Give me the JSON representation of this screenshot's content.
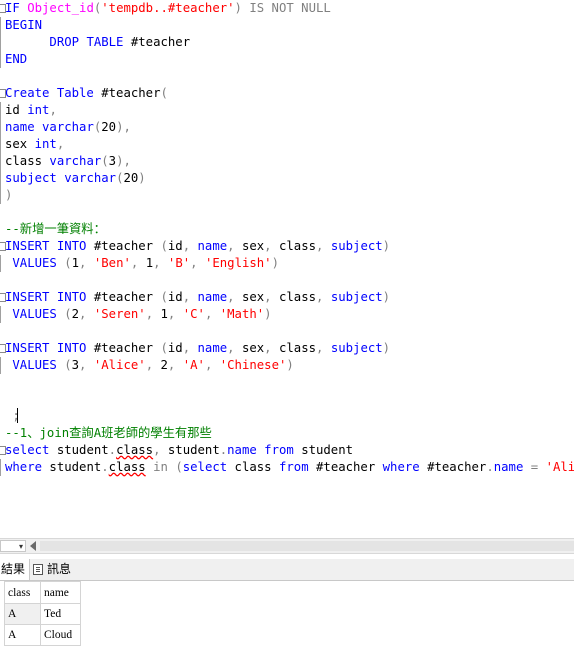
{
  "editor": {
    "lines": [
      [
        {
          "t": "IF ",
          "c": "kw"
        },
        {
          "t": "Object_id",
          "c": "fn"
        },
        {
          "t": "(",
          "c": "gray"
        },
        {
          "t": "'tempdb..#teacher'",
          "c": "str"
        },
        {
          "t": ")",
          "c": "gray"
        },
        {
          "t": " IS NOT NULL",
          "c": "gray"
        }
      ],
      [
        {
          "t": "BEGIN",
          "c": "kw"
        }
      ],
      [
        {
          "t": "      ",
          "c": ""
        },
        {
          "t": "DROP TABLE",
          "c": "kw"
        },
        {
          "t": " #teacher",
          "c": ""
        }
      ],
      [
        {
          "t": "END",
          "c": "kw"
        }
      ],
      [],
      [
        {
          "t": "Create Table",
          "c": "kw"
        },
        {
          "t": " #teacher",
          "c": ""
        },
        {
          "t": "(",
          "c": "gray"
        }
      ],
      [
        {
          "t": "id ",
          "c": ""
        },
        {
          "t": "int",
          "c": "kw"
        },
        {
          "t": ",",
          "c": "gray"
        }
      ],
      [
        {
          "t": "name ",
          "c": "kw"
        },
        {
          "t": "varchar",
          "c": "kw"
        },
        {
          "t": "(",
          "c": "gray"
        },
        {
          "t": "20",
          "c": ""
        },
        {
          "t": "),",
          "c": "gray"
        }
      ],
      [
        {
          "t": "sex ",
          "c": ""
        },
        {
          "t": "int",
          "c": "kw"
        },
        {
          "t": ",",
          "c": "gray"
        }
      ],
      [
        {
          "t": "class ",
          "c": ""
        },
        {
          "t": "varchar",
          "c": "kw"
        },
        {
          "t": "(",
          "c": "gray"
        },
        {
          "t": "3",
          "c": ""
        },
        {
          "t": "),",
          "c": "gray"
        }
      ],
      [
        {
          "t": "subject ",
          "c": "kw"
        },
        {
          "t": "varchar",
          "c": "kw"
        },
        {
          "t": "(",
          "c": "gray"
        },
        {
          "t": "20",
          "c": ""
        },
        {
          "t": ")",
          "c": "gray"
        }
      ],
      [
        {
          "t": ")",
          "c": "gray"
        }
      ],
      [],
      [
        {
          "t": "--新增一筆資料：",
          "c": "cm"
        }
      ],
      [
        {
          "t": "INSERT INTO",
          "c": "kw"
        },
        {
          "t": " #teacher ",
          "c": ""
        },
        {
          "t": "(",
          "c": "gray"
        },
        {
          "t": "id",
          "c": ""
        },
        {
          "t": ", ",
          "c": "gray"
        },
        {
          "t": "name",
          "c": "kw"
        },
        {
          "t": ", ",
          "c": "gray"
        },
        {
          "t": "sex",
          "c": ""
        },
        {
          "t": ", ",
          "c": "gray"
        },
        {
          "t": "class",
          "c": ""
        },
        {
          "t": ", ",
          "c": "gray"
        },
        {
          "t": "subject",
          "c": "kw"
        },
        {
          "t": ")",
          "c": "gray"
        }
      ],
      [
        {
          "t": " VALUES ",
          "c": "kw"
        },
        {
          "t": "(",
          "c": "gray"
        },
        {
          "t": "1",
          "c": ""
        },
        {
          "t": ", ",
          "c": "gray"
        },
        {
          "t": "'Ben'",
          "c": "str"
        },
        {
          "t": ", ",
          "c": "gray"
        },
        {
          "t": "1",
          "c": ""
        },
        {
          "t": ", ",
          "c": "gray"
        },
        {
          "t": "'B'",
          "c": "str"
        },
        {
          "t": ", ",
          "c": "gray"
        },
        {
          "t": "'English'",
          "c": "str"
        },
        {
          "t": ")",
          "c": "gray"
        }
      ],
      [],
      [
        {
          "t": "INSERT INTO",
          "c": "kw"
        },
        {
          "t": " #teacher ",
          "c": ""
        },
        {
          "t": "(",
          "c": "gray"
        },
        {
          "t": "id",
          "c": ""
        },
        {
          "t": ", ",
          "c": "gray"
        },
        {
          "t": "name",
          "c": "kw"
        },
        {
          "t": ", ",
          "c": "gray"
        },
        {
          "t": "sex",
          "c": ""
        },
        {
          "t": ", ",
          "c": "gray"
        },
        {
          "t": "class",
          "c": ""
        },
        {
          "t": ", ",
          "c": "gray"
        },
        {
          "t": "subject",
          "c": "kw"
        },
        {
          "t": ")",
          "c": "gray"
        }
      ],
      [
        {
          "t": " VALUES ",
          "c": "kw"
        },
        {
          "t": "(",
          "c": "gray"
        },
        {
          "t": "2",
          "c": ""
        },
        {
          "t": ", ",
          "c": "gray"
        },
        {
          "t": "'Seren'",
          "c": "str"
        },
        {
          "t": ", ",
          "c": "gray"
        },
        {
          "t": "1",
          "c": ""
        },
        {
          "t": ", ",
          "c": "gray"
        },
        {
          "t": "'C'",
          "c": "str"
        },
        {
          "t": ", ",
          "c": "gray"
        },
        {
          "t": "'Math'",
          "c": "str"
        },
        {
          "t": ")",
          "c": "gray"
        }
      ],
      [],
      [
        {
          "t": "INSERT INTO",
          "c": "kw"
        },
        {
          "t": " #teacher ",
          "c": ""
        },
        {
          "t": "(",
          "c": "gray"
        },
        {
          "t": "id",
          "c": ""
        },
        {
          "t": ", ",
          "c": "gray"
        },
        {
          "t": "name",
          "c": "kw"
        },
        {
          "t": ", ",
          "c": "gray"
        },
        {
          "t": "sex",
          "c": ""
        },
        {
          "t": ", ",
          "c": "gray"
        },
        {
          "t": "class",
          "c": ""
        },
        {
          "t": ", ",
          "c": "gray"
        },
        {
          "t": "subject",
          "c": "kw"
        },
        {
          "t": ")",
          "c": "gray"
        }
      ],
      [
        {
          "t": " VALUES ",
          "c": "kw"
        },
        {
          "t": "(",
          "c": "gray"
        },
        {
          "t": "3",
          "c": ""
        },
        {
          "t": ", ",
          "c": "gray"
        },
        {
          "t": "'Alice'",
          "c": "str"
        },
        {
          "t": ", ",
          "c": "gray"
        },
        {
          "t": "2",
          "c": ""
        },
        {
          "t": ", ",
          "c": "gray"
        },
        {
          "t": "'A'",
          "c": "str"
        },
        {
          "t": ", ",
          "c": "gray"
        },
        {
          "t": "'Chinese'",
          "c": "str"
        },
        {
          "t": ")",
          "c": "gray"
        }
      ],
      [],
      [],
      [
        {
          "t": " ;",
          "c": "gray"
        }
      ],
      [
        {
          "t": "--1、join查詢A班老師的學生有那些",
          "c": "cm"
        }
      ],
      [
        {
          "t": "select",
          "c": "kw"
        },
        {
          "t": " student",
          "c": ""
        },
        {
          "t": ".",
          "c": "gray"
        },
        {
          "t": "class",
          "c": "err"
        },
        {
          "t": ", ",
          "c": "gray"
        },
        {
          "t": "student",
          "c": ""
        },
        {
          "t": ".",
          "c": "gray"
        },
        {
          "t": "name",
          "c": "kw"
        },
        {
          "t": " from ",
          "c": "kw"
        },
        {
          "t": "student",
          "c": ""
        }
      ],
      [
        {
          "t": "where",
          "c": "kw"
        },
        {
          "t": " student",
          "c": ""
        },
        {
          "t": ".",
          "c": "gray"
        },
        {
          "t": "class",
          "c": "err"
        },
        {
          "t": " in ",
          "c": "gray"
        },
        {
          "t": "(",
          "c": "gray"
        },
        {
          "t": "select",
          "c": "kw"
        },
        {
          "t": " class ",
          "c": ""
        },
        {
          "t": "from",
          "c": "kw"
        },
        {
          "t": " #teacher ",
          "c": ""
        },
        {
          "t": "where",
          "c": "kw"
        },
        {
          "t": " #teacher",
          "c": ""
        },
        {
          "t": ".",
          "c": "gray"
        },
        {
          "t": "name",
          "c": "kw"
        },
        {
          "t": " = ",
          "c": "gray"
        },
        {
          "t": "'Alice'",
          "c": "str"
        },
        {
          "t": ")",
          "c": "gray"
        }
      ]
    ]
  },
  "status": {
    "zoom_dropdown": "▾"
  },
  "tabs": {
    "results": "結果",
    "messages": "訊息"
  },
  "grid": {
    "columns": [
      "class",
      "name"
    ],
    "rows": [
      [
        "A",
        "Ted"
      ],
      [
        "A",
        "Cloud"
      ]
    ]
  }
}
